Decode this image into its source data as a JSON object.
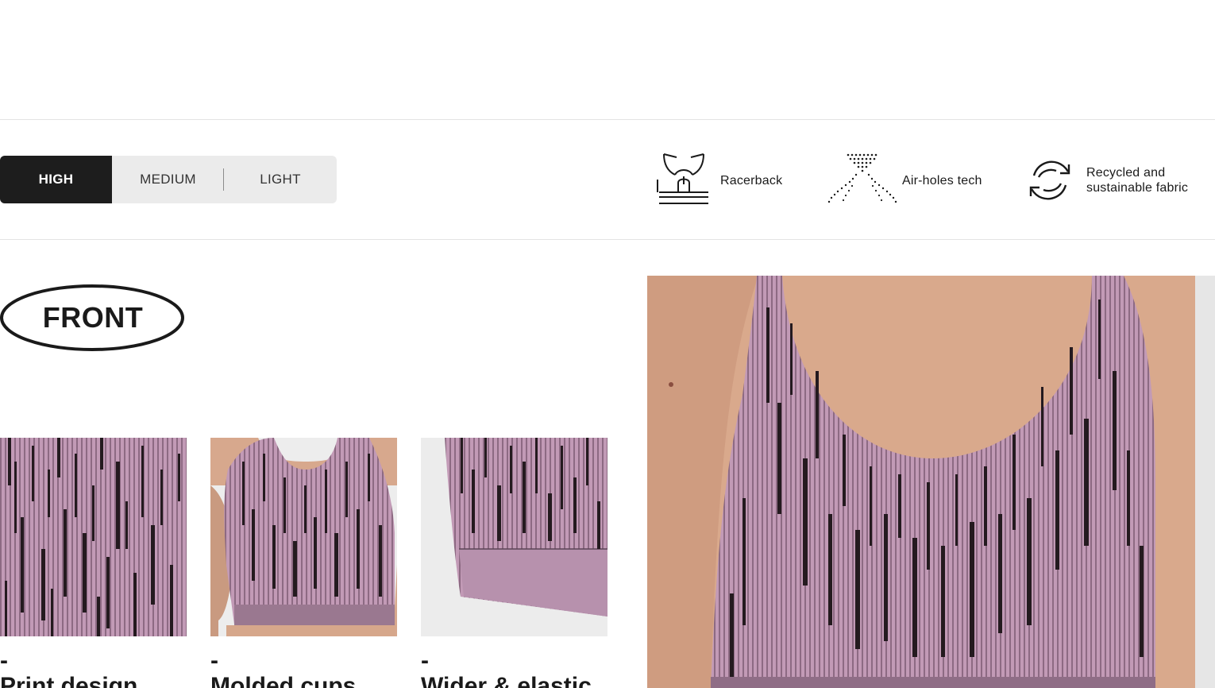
{
  "support_levels": {
    "high": "HIGH",
    "medium": "MEDIUM",
    "light": "LIGHT"
  },
  "features": [
    {
      "icon": "racerback-icon",
      "label": "Racerback"
    },
    {
      "icon": "air-holes-icon",
      "label": "Air-holes tech"
    },
    {
      "icon": "recycle-icon",
      "label_line1": "Recycled and",
      "label_line2": "sustainable fabric"
    }
  ],
  "section": {
    "badge": "FRONT"
  },
  "thumbnails": [
    {
      "dash": "-",
      "caption": "Print design"
    },
    {
      "dash": "-",
      "caption": "Molded cups"
    },
    {
      "dash": "-",
      "caption": "Wider & elastic"
    }
  ],
  "colors": {
    "fabric_pink": "#b48aa8",
    "fabric_dark": "#2a1c22",
    "skin": "#d9a98c",
    "selector_bg": "#ebebeb",
    "active_bg": "#1d1d1d"
  }
}
